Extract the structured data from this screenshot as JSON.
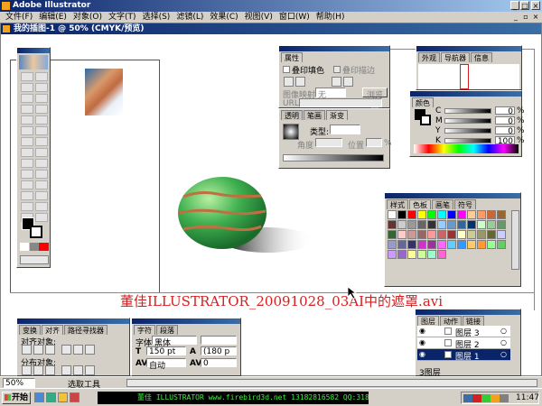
{
  "app": {
    "title": "Adobe Illustrator",
    "doc_title": "我的插图-1 @ 50% (CMYK/预览)"
  },
  "menu": [
    "文件(F)",
    "编辑(E)",
    "对象(O)",
    "文字(T)",
    "选择(S)",
    "滤镜(L)",
    "效果(C)",
    "视图(V)",
    "窗口(W)",
    "帮助(H)"
  ],
  "attributes_panel": {
    "tab": "属性",
    "overprint_fill": "叠印填色",
    "overprint_stroke": "叠印描边",
    "image_map_label": "图像映射:",
    "image_map_value": "无",
    "browser_btn": "浏览器",
    "url_label": "URL:"
  },
  "gradient_panel": {
    "tabs": [
      "透明",
      "笔画",
      "渐变"
    ],
    "type_label": "类型:",
    "angle_label": "角度",
    "position_label": "位置",
    "pct": "%"
  },
  "navigator_panel": {
    "tabs": [
      "外观",
      "导航器",
      "信息"
    ]
  },
  "color_panel": {
    "tab": "颜色",
    "channels": [
      "C",
      "M",
      "Y",
      "K"
    ],
    "values": [
      "0",
      "0",
      "0",
      "100"
    ],
    "pct": "%"
  },
  "swatches_panel": {
    "tabs": [
      "样式",
      "色板",
      "画笔",
      "符号"
    ]
  },
  "transform_panel": {
    "tabs": [
      "变换",
      "对齐",
      "路径寻找器"
    ],
    "align_label": "对齐对象:",
    "distribute_label": "分布对象:"
  },
  "character_panel": {
    "tabs": [
      "字符",
      "段落"
    ],
    "font_label": "字体",
    "font_value": "黑体",
    "size": "150 pt",
    "leading": "(180 p",
    "tracking_mode": "自动",
    "tracking": "0"
  },
  "layers_panel": {
    "tabs": [
      "图层",
      "动作",
      "链接"
    ],
    "layers": [
      "图层 3",
      "图层 2",
      "图层 1"
    ],
    "count": "3图层"
  },
  "caption": "董佳ILLUSTRATOR_20091028_03AI中的遮罩.avi",
  "status": {
    "zoom": "50%",
    "tool": "选取工具"
  },
  "taskbar": {
    "start": "开始",
    "item": "董佳 ILLUSTRATOR  www.firebird3d.net  13182816582  QQ:31837740",
    "clock": "11:47"
  }
}
